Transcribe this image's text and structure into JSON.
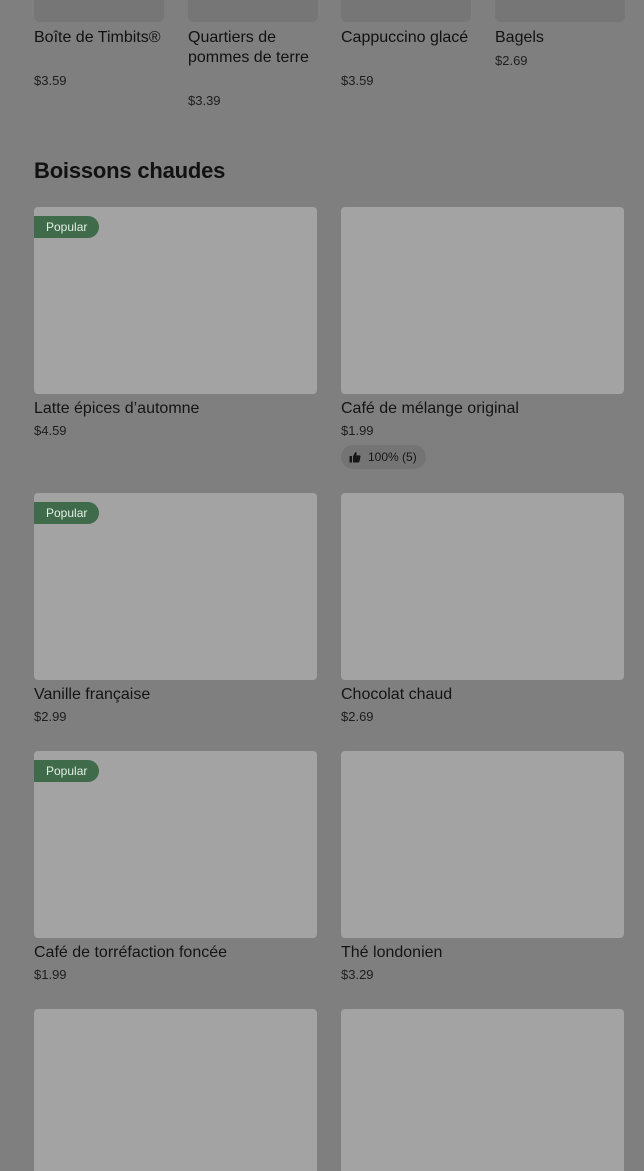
{
  "carousel": [
    {
      "name": "Boîte de Timbits®",
      "price": "$3.59"
    },
    {
      "name": "Quartiers de pommes de terre",
      "price": "$3.39"
    },
    {
      "name": "Cappuccino glacé",
      "price": "$3.59"
    },
    {
      "name": "Bagels",
      "price": "$2.69"
    }
  ],
  "section": {
    "title": "Boissons chaudes"
  },
  "cards": [
    {
      "name": "Latte épices d’automne",
      "price": "$4.59",
      "badge": "Popular"
    },
    {
      "name": "Café de mélange original",
      "price": "$1.99",
      "rating": "100% (5)"
    },
    {
      "name": "Vanille française",
      "price": "$2.99",
      "badge": "Popular"
    },
    {
      "name": "Chocolat chaud",
      "price": "$2.69"
    },
    {
      "name": "Café de torréfaction foncée",
      "price": "$1.99",
      "badge": "Popular"
    },
    {
      "name": "Thé londonien",
      "price": "$3.29"
    }
  ],
  "colors": {
    "badge": "#3f6b4a",
    "overlay": "#7f7f7f"
  }
}
